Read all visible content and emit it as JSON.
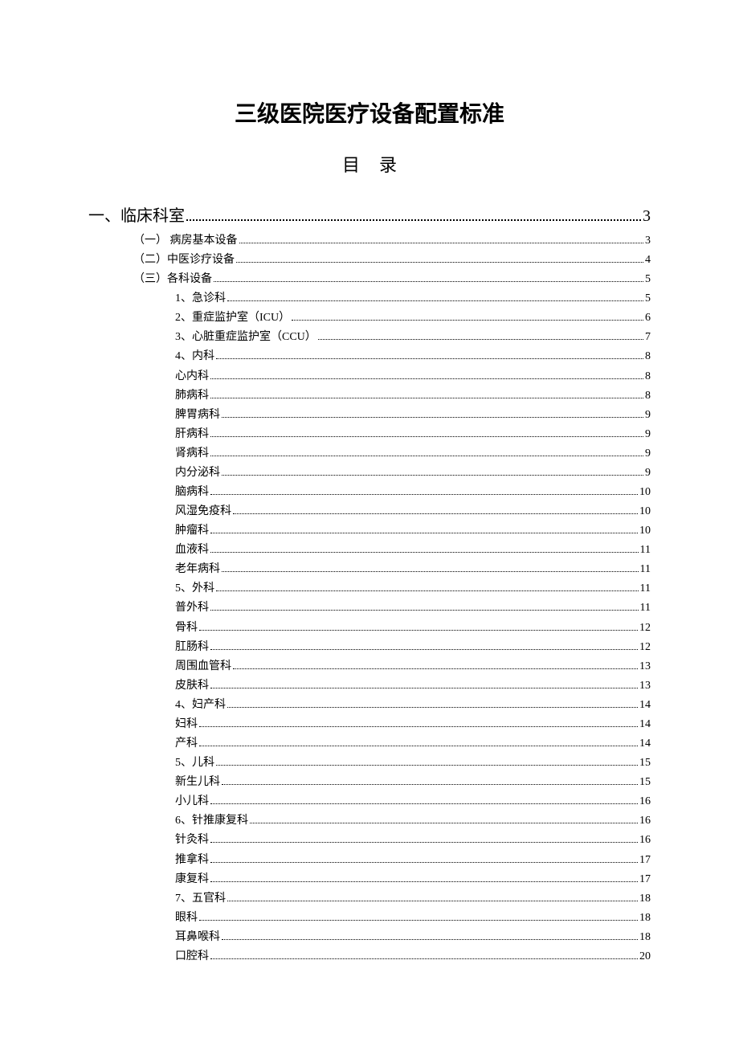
{
  "title": "三级医院医疗设备配置标准",
  "subtitle": "目录",
  "toc": [
    {
      "level": 1,
      "label": "一、临床科室",
      "page": "3"
    },
    {
      "level": 2,
      "label": "（一） 病房基本设备",
      "page": "3"
    },
    {
      "level": 2,
      "label": "（二）中医诊疗设备",
      "page": "4"
    },
    {
      "level": 2,
      "label": "（三）各科设备",
      "page": "5"
    },
    {
      "level": 3,
      "label": "1、急诊科",
      "page": "5"
    },
    {
      "level": 3,
      "label": "2、重症监护室（ICU）",
      "page": "6"
    },
    {
      "level": 3,
      "label": "3、心脏重症监护室（CCU）",
      "page": "7"
    },
    {
      "level": 3,
      "label": "4、内科",
      "page": "8"
    },
    {
      "level": 3,
      "label": "心内科",
      "page": "8"
    },
    {
      "level": 3,
      "label": "肺病科",
      "page": "8"
    },
    {
      "level": 3,
      "label": "脾胃病科",
      "page": "9"
    },
    {
      "level": 3,
      "label": "肝病科",
      "page": "9"
    },
    {
      "level": 3,
      "label": "肾病科",
      "page": "9"
    },
    {
      "level": 3,
      "label": "内分泌科",
      "page": "9"
    },
    {
      "level": 3,
      "label": "脑病科",
      "page": "10"
    },
    {
      "level": 3,
      "label": "风湿免疫科",
      "page": "10"
    },
    {
      "level": 3,
      "label": "肿瘤科",
      "page": "10"
    },
    {
      "level": 3,
      "label": "血液科",
      "page": "11"
    },
    {
      "level": 3,
      "label": "老年病科",
      "page": "11"
    },
    {
      "level": 3,
      "label": "5、外科",
      "page": "11"
    },
    {
      "level": 3,
      "label": "普外科",
      "page": "11"
    },
    {
      "level": 3,
      "label": "骨科",
      "page": "12"
    },
    {
      "level": 3,
      "label": "肛肠科",
      "page": "12"
    },
    {
      "level": 3,
      "label": "周围血管科",
      "page": "13"
    },
    {
      "level": 3,
      "label": "皮肤科",
      "page": "13"
    },
    {
      "level": 3,
      "label": "4、妇产科",
      "page": "14"
    },
    {
      "level": 3,
      "label": "妇科",
      "page": "14"
    },
    {
      "level": 3,
      "label": "产科",
      "page": "14"
    },
    {
      "level": 3,
      "label": "5、儿科",
      "page": "15"
    },
    {
      "level": 3,
      "label": "新生儿科",
      "page": "15"
    },
    {
      "level": 3,
      "label": "小儿科",
      "page": "16"
    },
    {
      "level": 3,
      "label": "6、针推康复科",
      "page": "16"
    },
    {
      "level": 3,
      "label": "针灸科",
      "page": "16"
    },
    {
      "level": 3,
      "label": "推拿科",
      "page": "17"
    },
    {
      "level": 3,
      "label": "康复科",
      "page": "17"
    },
    {
      "level": 3,
      "label": "7、五官科",
      "page": "18"
    },
    {
      "level": 3,
      "label": "眼科",
      "page": "18"
    },
    {
      "level": 3,
      "label": "耳鼻喉科",
      "page": "18"
    },
    {
      "level": 3,
      "label": "口腔科",
      "page": "20"
    }
  ]
}
